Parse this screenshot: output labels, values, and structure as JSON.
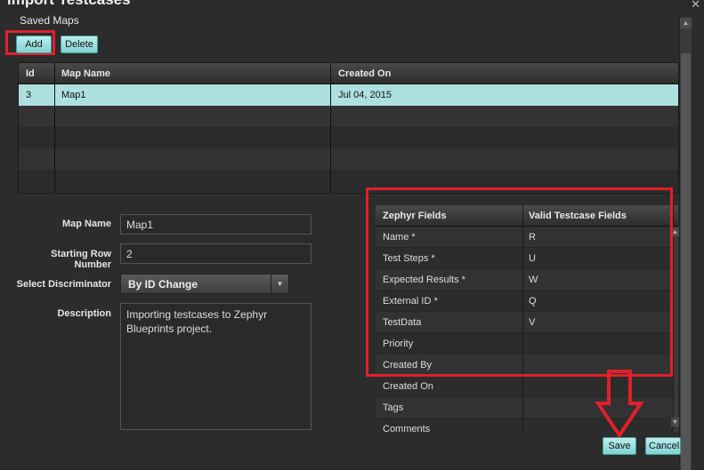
{
  "window": {
    "title": "Import Testcases"
  },
  "saved_maps": {
    "label": "Saved Maps",
    "add_label": "Add",
    "delete_label": "Delete",
    "columns": [
      "Id",
      "Map Name",
      "Created On"
    ],
    "rows": [
      {
        "id": "3",
        "name": "Map1",
        "created": "Jul 04, 2015"
      }
    ]
  },
  "form": {
    "map_name_label": "Map Name",
    "map_name_value": "Map1",
    "starting_row_label": "Starting Row Number",
    "starting_row_value": "2",
    "discriminator_label": "Select Discriminator",
    "discriminator_value": "By ID Change",
    "description_label": "Description",
    "description_value": "Importing testcases to Zephyr Blueprints project."
  },
  "field_map": {
    "columns": [
      "Zephyr Fields",
      "Valid Testcase Fields"
    ],
    "rows": [
      {
        "field": "Name *",
        "value": "R"
      },
      {
        "field": "Test Steps *",
        "value": "U"
      },
      {
        "field": "Expected Results *",
        "value": "W"
      },
      {
        "field": "External ID *",
        "value": "Q"
      },
      {
        "field": "TestData",
        "value": "V"
      },
      {
        "field": "Priority",
        "value": ""
      },
      {
        "field": "Created By",
        "value": ""
      },
      {
        "field": "Created On",
        "value": ""
      },
      {
        "field": "Tags",
        "value": ""
      },
      {
        "field": "Comments",
        "value": ""
      }
    ]
  },
  "actions": {
    "save_label": "Save",
    "cancel_label": "Cancel"
  },
  "colors": {
    "highlight": "#e0202a",
    "selection": "#aee0e0",
    "button": "#7fd3d3"
  }
}
